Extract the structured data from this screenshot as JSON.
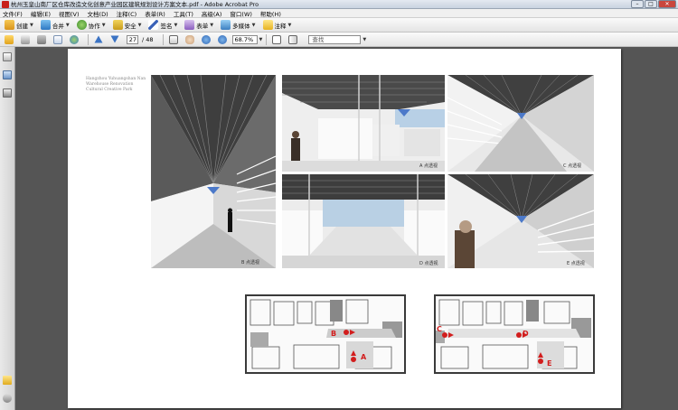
{
  "window": {
    "title": "杭州玉皇山南厂区仓库改造文化创意产业园区建筑规划设计方案文本.pdf - Adobe Acrobat Pro",
    "controls": [
      "–",
      "□",
      "✕"
    ]
  },
  "menu": [
    "文件(F)",
    "编辑(E)",
    "视图(V)",
    "文档(D)",
    "注释(C)",
    "表单(R)",
    "工具(T)",
    "高级(A)",
    "窗口(W)",
    "帮助(H)"
  ],
  "toolbar_top": {
    "create": "创建",
    "combine": "合并",
    "collaborate": "协作",
    "secure": "安全",
    "sign": "签名",
    "forms": "表单",
    "multimedia": "多媒体",
    "comment": "注释"
  },
  "toolbar_nav": {
    "page_current": "27",
    "page_total": "/ 48",
    "zoom": "68.7%",
    "find_placeholder": "查找"
  },
  "document": {
    "caption": "Hangzhou Yuhuangshan Nan\nWarehouse Renovation\nCultural Creative Park",
    "renders": [
      {
        "label": "B 点透视"
      },
      {
        "label": "A 点透视"
      },
      {
        "label": "C 点透视"
      },
      {
        "label": "D 点透视"
      },
      {
        "label": "E 点透视"
      }
    ],
    "markers": [
      "A",
      "B",
      "C",
      "D",
      "E"
    ]
  },
  "colors": {
    "accent_red": "#d21d1d",
    "sky_blue": "#4c79c9",
    "titlebar": "#c8d3e0",
    "page_bg": "#555555"
  }
}
